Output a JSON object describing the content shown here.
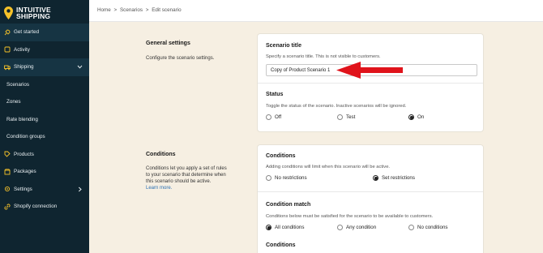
{
  "brand": {
    "line1": "INTUITIVE",
    "line2": "SHIPPING"
  },
  "colors": {
    "sidebar": "#0f2530",
    "accent": "#f6c229",
    "arrow": "#e0131b",
    "page_bg": "#f6efe2"
  },
  "sidebar": {
    "items": [
      {
        "label": "Get started",
        "icon": "rocket-icon"
      },
      {
        "label": "Activity",
        "icon": "activity-icon"
      },
      {
        "label": "Shipping",
        "icon": "truck-icon"
      },
      {
        "label": "Scenarios"
      },
      {
        "label": "Zones"
      },
      {
        "label": "Rate blending"
      },
      {
        "label": "Condition groups"
      },
      {
        "label": "Products",
        "icon": "tag-icon"
      },
      {
        "label": "Packages",
        "icon": "package-icon"
      },
      {
        "label": "Settings",
        "icon": "gear-icon"
      },
      {
        "label": "Shopify connection",
        "icon": "link-icon"
      }
    ]
  },
  "breadcrumb": [
    "Home",
    ">",
    "Scenarios",
    ">",
    "Edit scenario"
  ],
  "general": {
    "label": "General settings",
    "desc": "Configure the scenario settings.",
    "title_heading": "Scenario title",
    "title_help": "Specify a scenario title. This is not visible to customers.",
    "title_value": "Copy of Product Scenario 1",
    "status_heading": "Status",
    "status_help": "Toggle the status of the scenario. Inactive scenarios will be ignored.",
    "status_options": [
      "Off",
      "Test",
      "On"
    ],
    "status_selected": "On"
  },
  "conditions": {
    "label": "Conditions",
    "desc_lines": [
      "Conditions let you apply a set of rules",
      "to your scenario that determine when",
      "this scenario should be active."
    ],
    "learn_more": "Learn more.",
    "heading": "Conditions",
    "help": "Adding conditions will limit when this scenario will be active.",
    "options": [
      "No restrictions",
      "Set restrictions"
    ],
    "selected": "Set restrictions",
    "match_heading": "Condition match",
    "match_help": "Conditions below must be satisfied for the scenario to be available to customers.",
    "match_options": [
      "All conditions",
      "Any condition",
      "No conditions"
    ],
    "match_selected": "All conditions",
    "sub_heading": "Conditions"
  }
}
